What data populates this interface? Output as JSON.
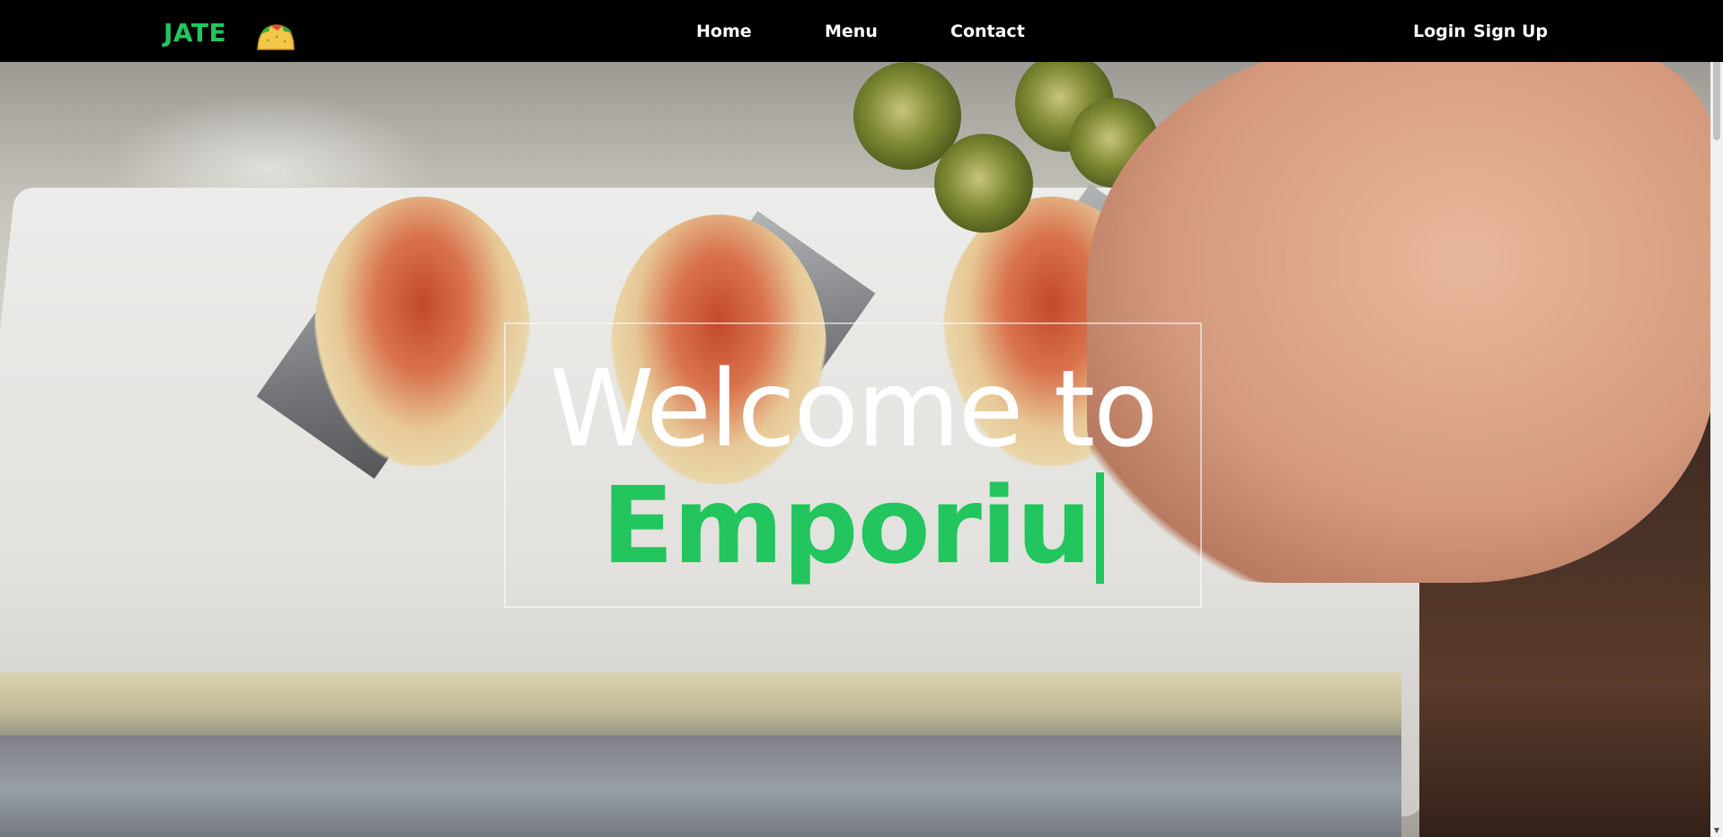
{
  "navbar": {
    "brand": "JATE",
    "brand_icon": "taco-icon",
    "links": [
      {
        "label": "Home"
      },
      {
        "label": "Menu"
      },
      {
        "label": "Contact"
      }
    ],
    "login_label": "Login",
    "signup_label": "Sign Up"
  },
  "hero": {
    "line1": "Welcome to",
    "line2": "Emporiu",
    "accent_color": "#22c55e",
    "background": "photo of tacos with jalapeño slices on a kitchen counter"
  },
  "scrollbar": {
    "up_icon": "scroll-up-arrow",
    "down_icon": "scroll-down-arrow"
  }
}
